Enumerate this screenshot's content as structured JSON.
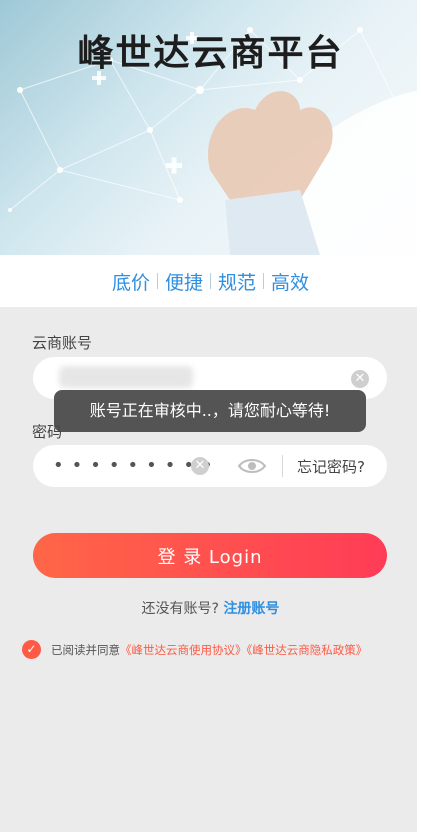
{
  "hero": {
    "title": "峰世达云商平台"
  },
  "slogan": [
    "底价",
    "便捷",
    "规范",
    "高效"
  ],
  "form": {
    "account_label": "云商账号",
    "password_label": "密码",
    "password_mask": "•••••••••",
    "forgot_label": "忘记密码?",
    "login_label": "登 录 Login"
  },
  "toast": "账号正在审核中..，请您耐心等待!",
  "register": {
    "prompt": "还没有账号?",
    "link": "注册账号"
  },
  "agreement": {
    "prefix": "已阅读并同意",
    "terms": "《峰世达云商使用协议》",
    "privacy": "《峰世达云商隐私政策》"
  },
  "colors": {
    "accent_blue": "#2f8fe0",
    "accent_red": "#ff4b50"
  }
}
